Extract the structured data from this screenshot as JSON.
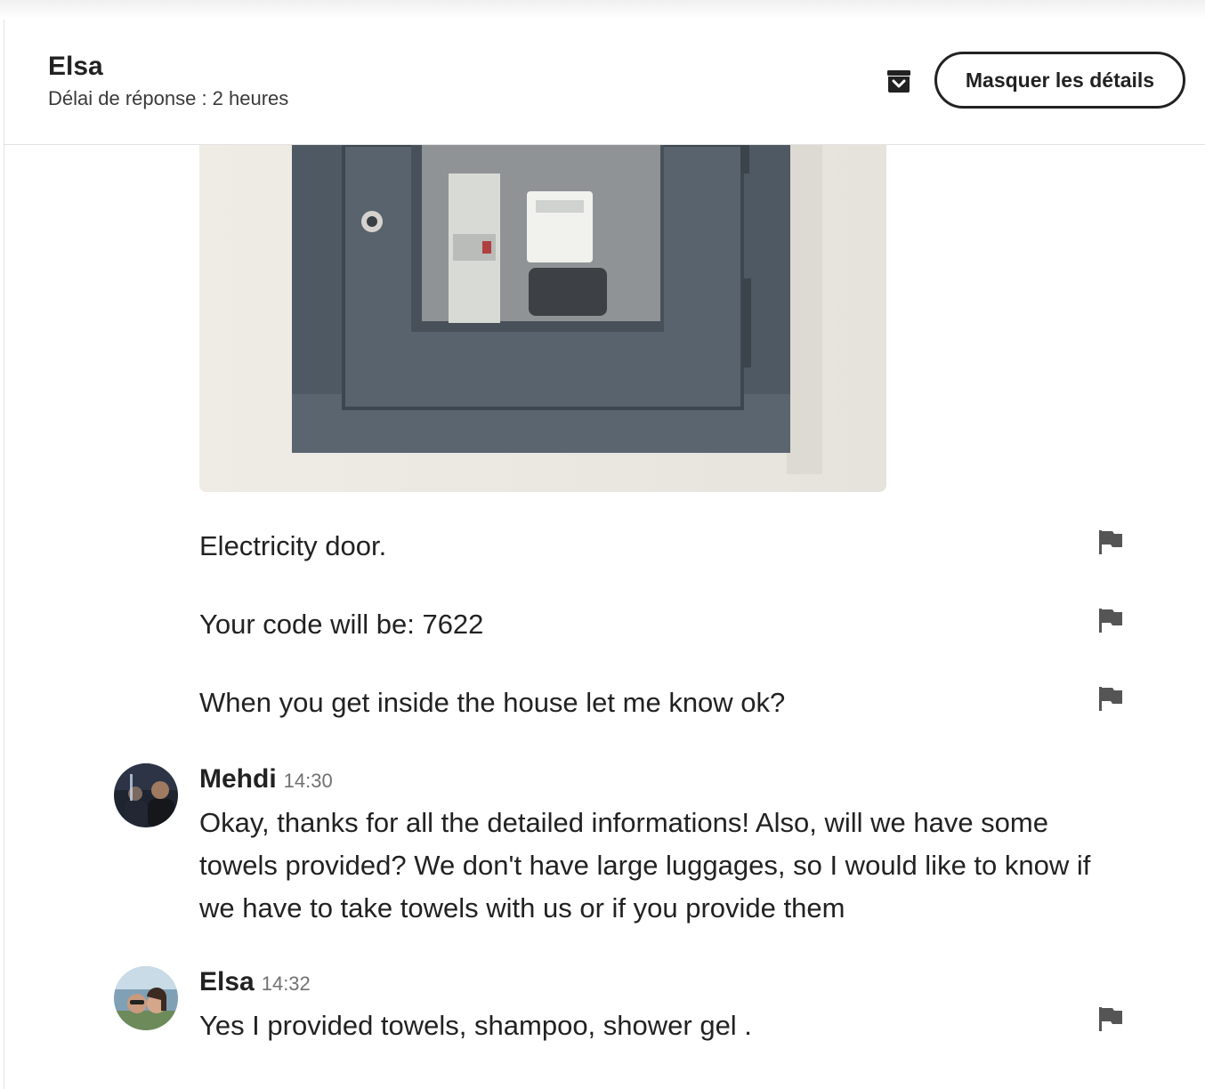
{
  "header": {
    "name": "Elsa",
    "response_time": "Délai de réponse : 2 heures",
    "archive_icon": "archive-icon",
    "details_button": "Masquer les détails"
  },
  "thread": {
    "image_alt": "Electricity meter cabinet door",
    "lines": [
      "Electricity door.",
      "Your code will be: 7622",
      "When you get inside the house let me know ok?"
    ],
    "messages": [
      {
        "sender": "Mehdi",
        "time": "14:30",
        "text": "Okay, thanks for all the detailed informations! Also, will we have some towels provided? We don't have large luggages, so I would like to know if we have to take towels with us or if you provide them"
      },
      {
        "sender": "Elsa",
        "time": "14:32",
        "text": "Yes I provided towels, shampoo, shower gel ."
      }
    ]
  },
  "icons": {
    "flag": "flag-icon"
  }
}
